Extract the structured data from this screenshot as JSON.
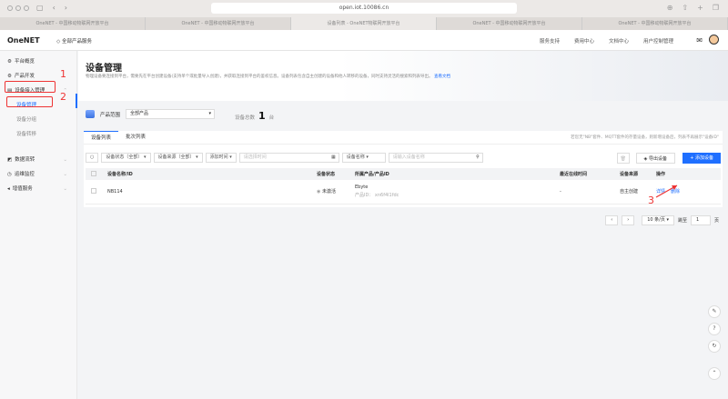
{
  "browser": {
    "url": "open.iot.10086.cn",
    "tabs": [
      {
        "label": "OneNET - 中国移动物联网开放平台"
      },
      {
        "label": "OneNET - 中国移动物联网开放平台"
      },
      {
        "label": "设备列表 - OneNET物联网开放平台"
      },
      {
        "label": "OneNET - 中国移动物联网开放平台"
      },
      {
        "label": "OneNET - 中国移动物联网开放平台"
      }
    ]
  },
  "topnav": {
    "logo": "OneNET",
    "all_products": "全部产品服务",
    "links": [
      "服务支持",
      "费用中心",
      "文档中心",
      "用户控制管理"
    ]
  },
  "sidebar": {
    "items": [
      {
        "label": "平台概览"
      },
      {
        "label": "产品开发"
      },
      {
        "label": "设备接入管理"
      },
      {
        "label": "设备管理"
      },
      {
        "label": "设备分组"
      },
      {
        "label": "设备转移"
      },
      {
        "label": "数据流转"
      },
      {
        "label": "运维监控"
      },
      {
        "label": "增值服务"
      }
    ]
  },
  "annotations": [
    "1",
    "2",
    "3"
  ],
  "hero": {
    "title": "设备管理",
    "desc": "物理设备要连接到平台，需要先在平台创建设备(支持单个或批量导入创建)，并获取连接到平台的鉴权信息。设备列表包含自主创建的设备和他人转移的设备，同时支持灵活的搜索和列表导出。",
    "doc_link": "查看文档"
  },
  "scope": {
    "label": "产品范围",
    "value": "全部产品",
    "total_label": "设备总数",
    "total": "1",
    "unit": "台"
  },
  "tabs": [
    "设备列表",
    "批次列表"
  ],
  "tip": "若您无\"NB\"套件、MQTT套件的存量设备，则新增设备后，列表不再展示\"设备ID\"",
  "filters": {
    "status": "设备状态（全部）",
    "source": "设备来源（全部）",
    "time": "添加时间",
    "time_placeholder": "请选择时间",
    "name_type": "设备名称",
    "name_placeholder": "请输入设备名称"
  },
  "buttons": {
    "export": "导出设备",
    "add": "+ 添加设备"
  },
  "table": {
    "headers": [
      "设备名称/ID",
      "设备状态",
      "所属产品/产品ID",
      "最近在线时间",
      "设备来源",
      "操作"
    ],
    "rows": [
      {
        "name": "NB114",
        "status": "未激活",
        "product": "Ebyte",
        "product_id": "产品ID： xn6f4l1fdc",
        "last_online": "-",
        "source": "自主创建",
        "actions": [
          "详情",
          "删除"
        ]
      }
    ]
  },
  "pager": {
    "size": "10 条/页",
    "jump": "跳至",
    "page": "1",
    "page_unit": "页"
  },
  "colors": {
    "accent": "#1f6fff",
    "annotation": "#e33333"
  }
}
